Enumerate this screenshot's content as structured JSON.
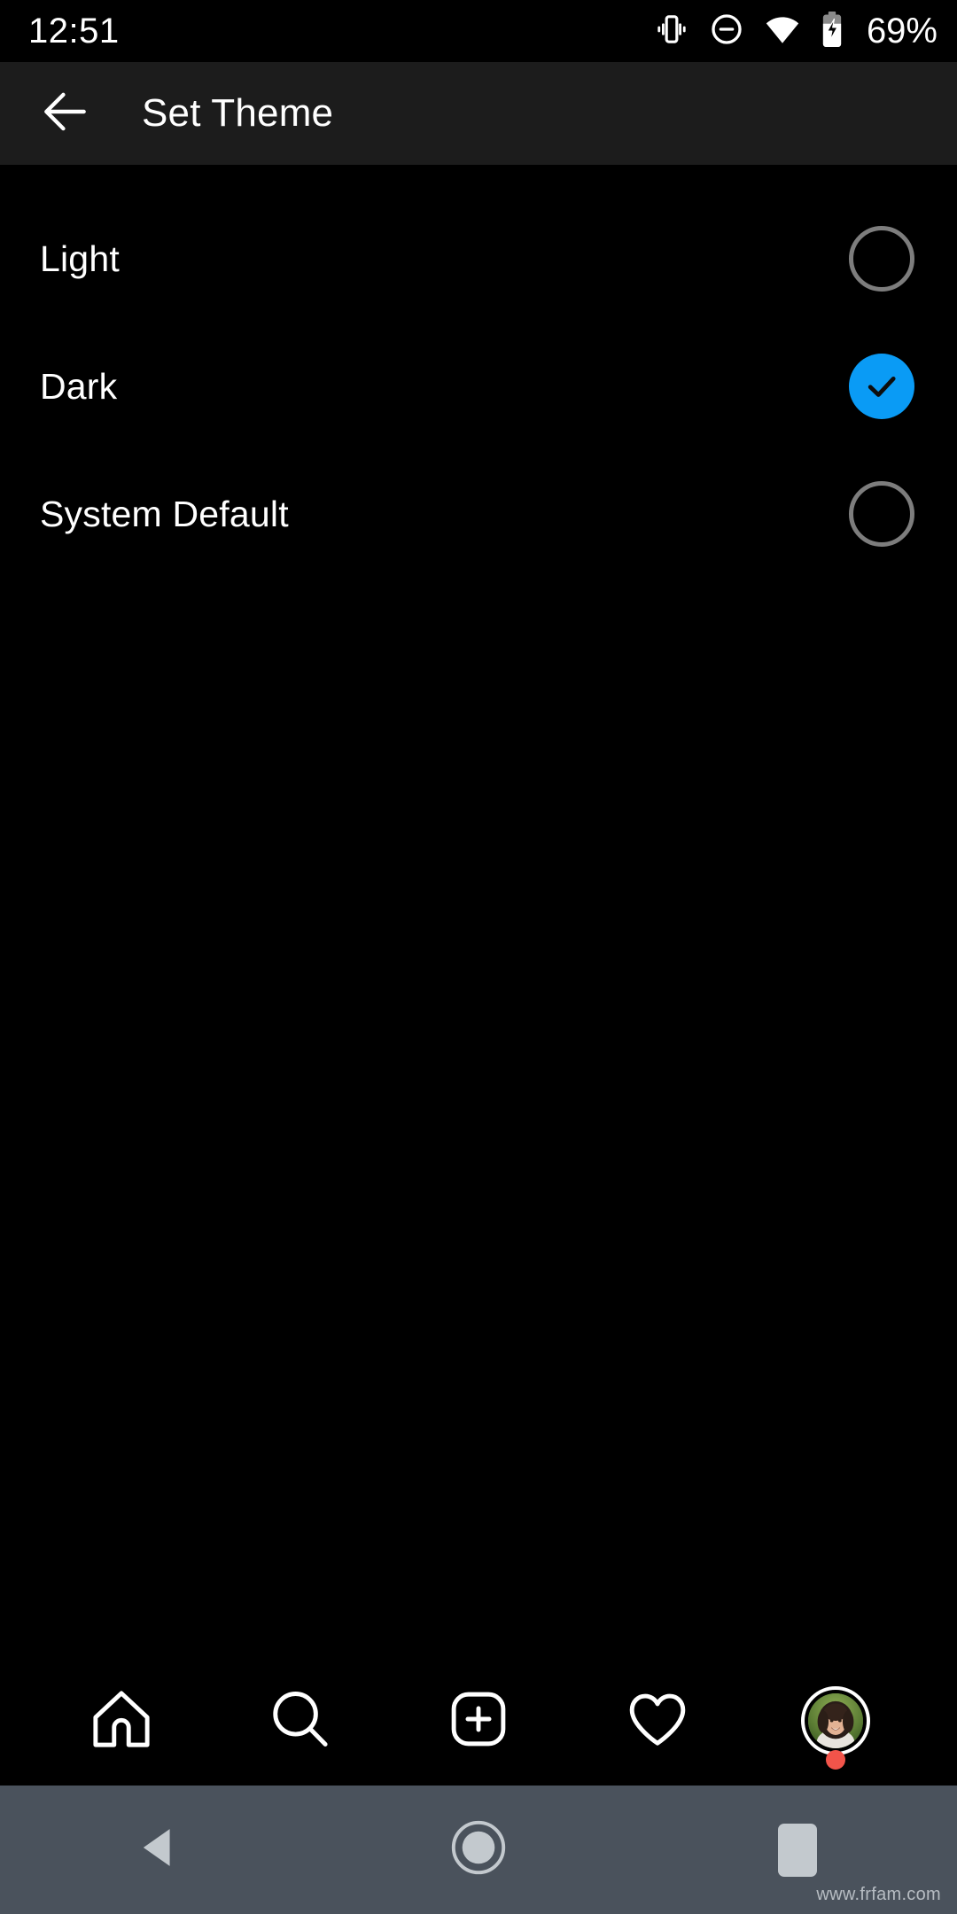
{
  "status_bar": {
    "time": "12:51",
    "battery_percent": "69%",
    "icons": [
      "vibrate-icon",
      "do-not-disturb-icon",
      "wifi-icon",
      "battery-charging-icon"
    ]
  },
  "app_bar": {
    "back_icon": "arrow-left-icon",
    "title": "Set Theme",
    "background_color": "#1c1c1c"
  },
  "theme_options": [
    {
      "label": "Light",
      "selected": false
    },
    {
      "label": "Dark",
      "selected": true
    },
    {
      "label": "System Default",
      "selected": false
    }
  ],
  "colors": {
    "accent_blue": "#0a9bf5",
    "screen_background": "#000000",
    "app_bar": "#1c1c1c",
    "radio_outline": "#7d7d7d",
    "nav_bar": "#4a525c",
    "notification_dot": "#f2544a"
  },
  "tab_bar": {
    "items": [
      {
        "name": "home-icon",
        "label": "Home"
      },
      {
        "name": "search-icon",
        "label": "Search"
      },
      {
        "name": "add-post-icon",
        "label": "New Post"
      },
      {
        "name": "heart-icon",
        "label": "Activity"
      },
      {
        "name": "profile-avatar",
        "label": "Profile"
      }
    ],
    "profile_has_notification": true
  },
  "android_nav": {
    "back_label": "Back",
    "home_label": "Home",
    "recents_label": "Recents"
  },
  "watermark": "www.frfam.com"
}
